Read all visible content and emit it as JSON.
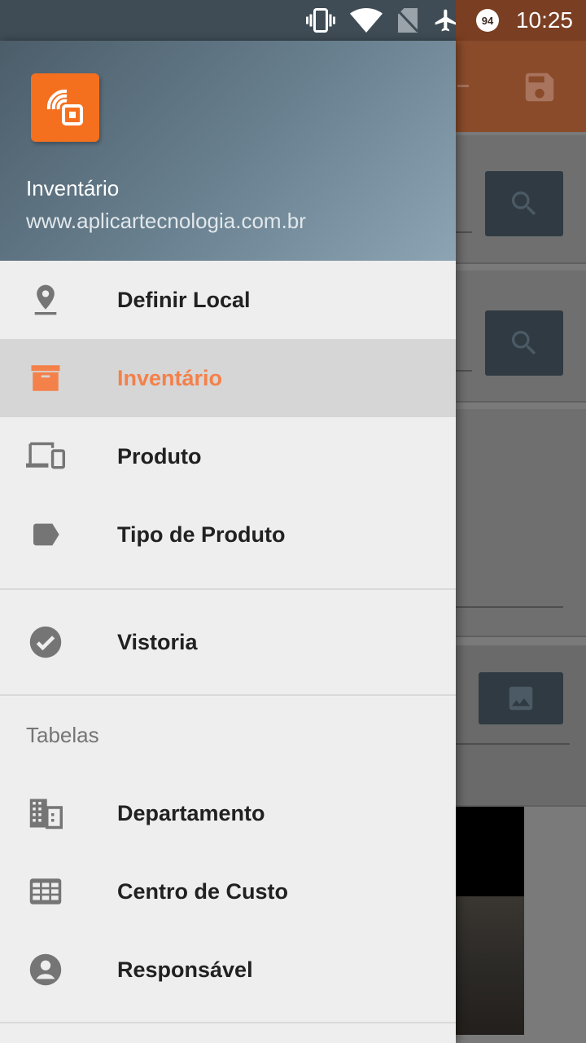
{
  "status_bar": {
    "time": "10:25",
    "battery_level": "94",
    "icons": [
      "vibrate-icon",
      "wifi-icon",
      "no-sim-icon",
      "airplane-icon",
      "battery-icon"
    ]
  },
  "drawer": {
    "header": {
      "title": "Inventário",
      "subtitle": "www.aplicartecnologia.com.br"
    },
    "items": [
      {
        "label": "Definir Local",
        "icon": "location-pin-icon",
        "active": false
      },
      {
        "label": "Inventário",
        "icon": "archive-box-icon",
        "active": true
      },
      {
        "label": "Produto",
        "icon": "devices-icon",
        "active": false
      },
      {
        "label": "Tipo de Produto",
        "icon": "label-tag-icon",
        "active": false
      }
    ],
    "secondary_items": [
      {
        "label": "Vistoria",
        "icon": "check-circle-icon"
      }
    ],
    "section_title": "Tabelas",
    "table_items": [
      {
        "label": "Departamento",
        "icon": "building-icon"
      },
      {
        "label": "Centro de Custo",
        "icon": "grid-table-icon"
      },
      {
        "label": "Responsável",
        "icon": "account-circle-icon"
      }
    ]
  },
  "colors": {
    "accent": "#f4701f",
    "active_text": "#f4804a",
    "header_start": "#4c5d6a",
    "header_end": "#8ca4b3"
  }
}
